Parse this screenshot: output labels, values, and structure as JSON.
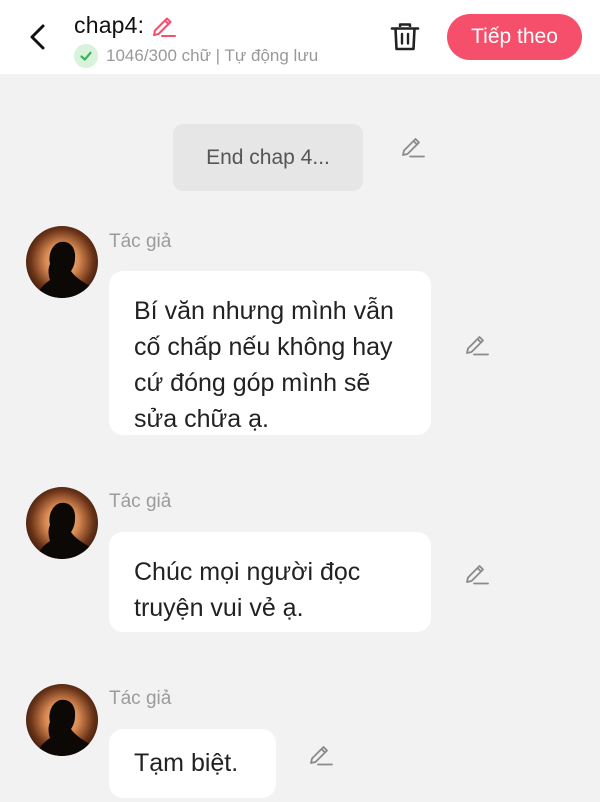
{
  "header": {
    "title": "chap4:",
    "word_status": "1046/300 chữ | Tự động lưu",
    "next_button": "Tiếp theo",
    "accent_color": "#f54f6b"
  },
  "narration": {
    "text": "End chap 4..."
  },
  "messages": [
    {
      "author": "Tác giả",
      "lines": [
        "Bí văn nhưng mình vẫn",
        "cố chấp nếu không hay",
        "cứ đóng góp mình sẽ",
        "sửa chữa ạ."
      ]
    },
    {
      "author": "Tác giả",
      "lines": [
        "Chúc mọi người đọc",
        "truyện vui vẻ ạ."
      ]
    },
    {
      "author": "Tác giả",
      "lines": [
        "Tạm biệt."
      ]
    }
  ],
  "icons": {
    "back": "chevron-left-icon",
    "title_edit": "pencil-icon",
    "status": "check-icon",
    "delete": "trash-icon",
    "edit": "pencil-icon"
  }
}
